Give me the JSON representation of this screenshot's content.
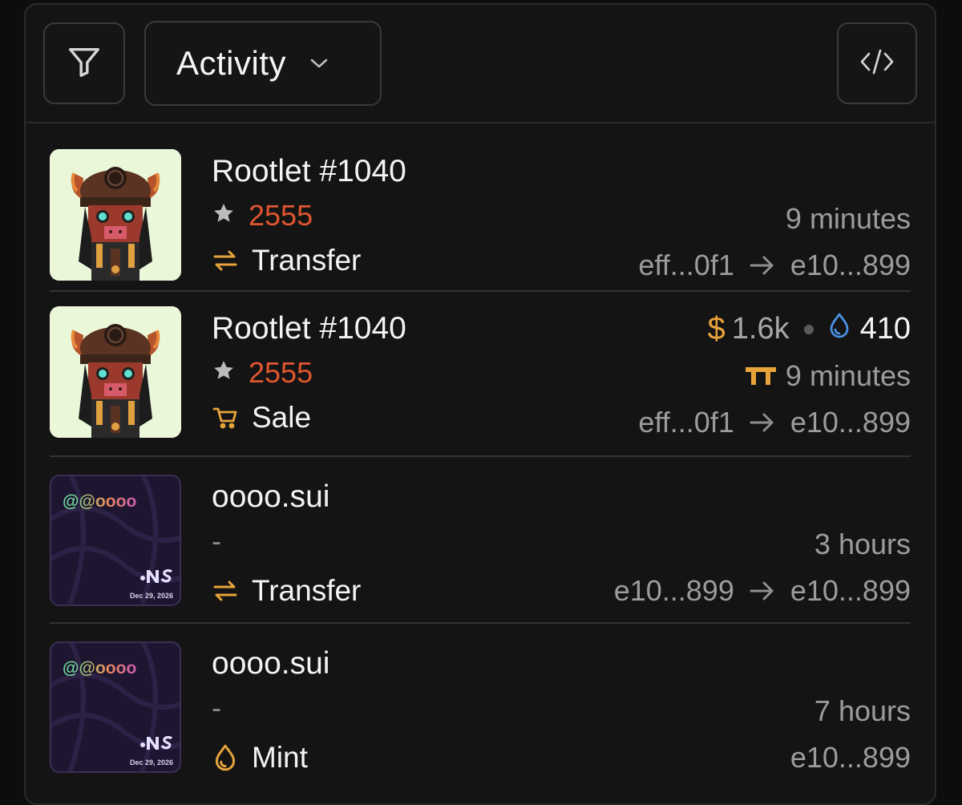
{
  "toolbar": {
    "filter_icon": "filter-icon",
    "select_label": "Activity",
    "chevron_icon": "chevron-down-icon",
    "code_icon": "code-icon"
  },
  "colors": {
    "rank": "#e0552f",
    "event_icon": "#e8a33b",
    "sui_drop": "#4a90e2",
    "muted_text": "#9c9c9c"
  },
  "activities": [
    {
      "name": "Rootlet #1040",
      "rank": "2555",
      "event": "Transfer",
      "event_icon": "transfer-icon",
      "time": "9 minutes",
      "from": "eff...0f1",
      "to": "e10...899"
    },
    {
      "name": "Rootlet #1040",
      "rank": "2555",
      "event": "Sale",
      "event_icon": "cart-icon",
      "usd_symbol": "$",
      "usd_value": "1.6k",
      "sui_value": "410",
      "marketplace_icon": "tradeport-icon",
      "time": "9 minutes",
      "from": "eff...0f1",
      "to": "e10...899"
    },
    {
      "name": "oooo.sui",
      "rank": "-",
      "event": "Transfer",
      "event_icon": "transfer-icon",
      "time": "3 hours",
      "from": "e10...899",
      "to": "e10...899",
      "nft_handle": "@oooo",
      "nft_date": "Dec 29, 2026"
    },
    {
      "name": "oooo.sui",
      "rank": "-",
      "event": "Mint",
      "event_icon": "sui-drop-icon",
      "time": "7 hours",
      "to": "e10...899",
      "nft_handle": "@oooo",
      "nft_date": "Dec 29, 2026"
    }
  ]
}
